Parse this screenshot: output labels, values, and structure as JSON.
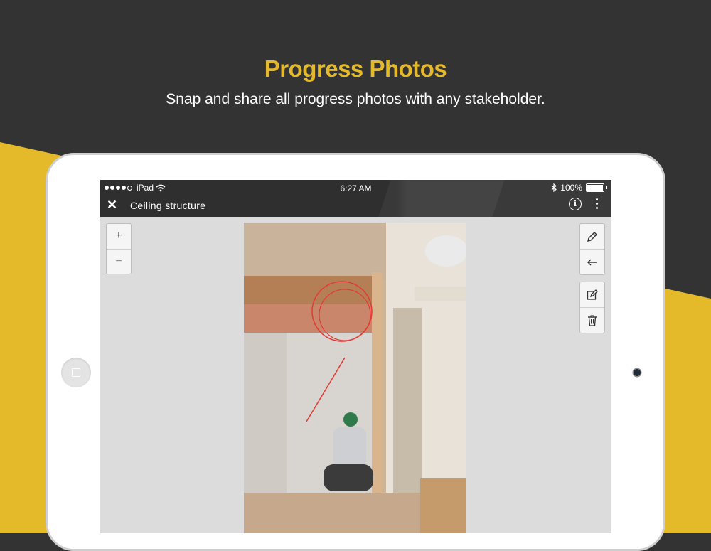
{
  "promo": {
    "headline": "Progress Photos",
    "subline": "Snap and share all progress photos with any stakeholder."
  },
  "colors": {
    "accent_yellow": "#E4B92A",
    "background_dark": "#333333",
    "navbar": "#2f2f2f"
  },
  "status_bar": {
    "carrier": "iPad",
    "time": "6:27 AM",
    "battery": "100%",
    "icons": [
      "signal-dots-icon",
      "wifi-icon",
      "bluetooth-icon",
      "battery-icon"
    ]
  },
  "navbar": {
    "title": "Ceiling structure",
    "icons": [
      "close-icon",
      "info-icon",
      "more-vertical-icon"
    ]
  },
  "zoom": {
    "plus": "+",
    "minus": "−"
  },
  "tools": {
    "group1": [
      "pencil-icon",
      "arrow-left-icon"
    ],
    "group2": [
      "edit-icon",
      "trash-icon"
    ]
  },
  "photo": {
    "subject": "construction-site-photo",
    "annotation_color": "#E53935"
  }
}
